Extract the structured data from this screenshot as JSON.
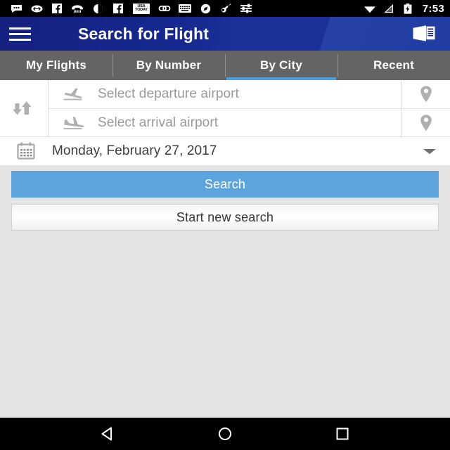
{
  "status_bar": {
    "icons": [
      {
        "name": "messages-icon",
        "glyph": "dots-bubble"
      },
      {
        "name": "skype-icon",
        "glyph": "skype"
      },
      {
        "name": "facebook-icon",
        "glyph": "facebook"
      },
      {
        "name": "phone-icon",
        "glyph": "phone"
      },
      {
        "name": "do-not-disturb-icon",
        "glyph": "moon"
      },
      {
        "name": "facebook-messenger-icon",
        "glyph": "facebook"
      },
      {
        "name": "usa-today-icon",
        "glyph": "usa-today",
        "label": "USA TODAY"
      },
      {
        "name": "link-icon",
        "glyph": "chain"
      },
      {
        "name": "keyboard-icon",
        "glyph": "keyboard"
      },
      {
        "name": "browser-icon",
        "glyph": "compass"
      },
      {
        "name": "music-icon",
        "glyph": "guitar"
      },
      {
        "name": "equalizer-icon",
        "glyph": "equalizer"
      }
    ],
    "right_icons": [
      {
        "name": "wifi-icon",
        "glyph": "wifi"
      },
      {
        "name": "signal-icon",
        "glyph": "signal-off"
      },
      {
        "name": "battery-charging-icon",
        "glyph": "battery-bolt"
      }
    ],
    "clock": "7:53"
  },
  "app_bar": {
    "menu_label": "menu",
    "title": "Search for Flight",
    "action_label": "news"
  },
  "tabs": {
    "items": [
      {
        "label": "My Flights",
        "active": false
      },
      {
        "label": "By Number",
        "active": false
      },
      {
        "label": "By City",
        "active": true
      },
      {
        "label": "Recent",
        "active": false
      }
    ],
    "active_index": 2,
    "indicator_color": "#4e9fe0"
  },
  "form": {
    "swap_label": "swap airports",
    "departure": {
      "placeholder": "Select departure airport",
      "value": "",
      "icon": "flight-takeoff-icon",
      "pin_label": "pick departure on map"
    },
    "arrival": {
      "placeholder": "Select arrival airport",
      "value": "",
      "icon": "flight-land-icon",
      "pin_label": "pick arrival on map"
    },
    "date": {
      "label": "Monday, February 27, 2017",
      "icon": "calendar-icon",
      "caret": "chevron-down-icon"
    }
  },
  "actions": {
    "search_label": "Search",
    "search_color": "#5ba4dd",
    "new_search_label": "Start new search"
  },
  "nav_bar": {
    "back_label": "Back",
    "home_label": "Home",
    "recents_label": "Recent apps"
  }
}
